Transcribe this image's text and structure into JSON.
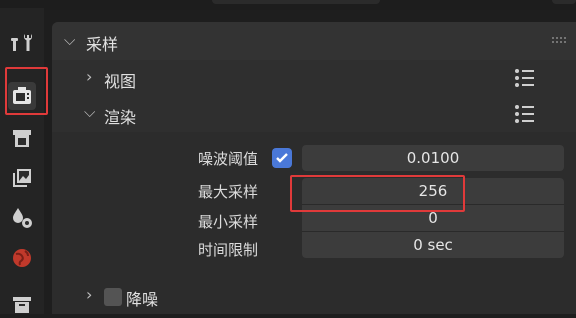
{
  "sidebar": {
    "items": [
      {
        "name": "tool"
      },
      {
        "name": "render",
        "active": true
      },
      {
        "name": "output"
      },
      {
        "name": "view-layer"
      },
      {
        "name": "scene"
      },
      {
        "name": "world"
      },
      {
        "name": "collection"
      }
    ]
  },
  "panel": {
    "title": "采样",
    "subpanels": {
      "viewport_label": "视图",
      "render_label": "渲染",
      "denoise_label": "降噪"
    }
  },
  "properties": {
    "noise_threshold": {
      "label": "噪波阈值",
      "value": "0.0100",
      "enabled": true
    },
    "max_samples": {
      "label": "最大采样",
      "value": "256"
    },
    "min_samples": {
      "label": "最小采样",
      "value": "0"
    },
    "time_limit": {
      "label": "时间限制",
      "value": "0 sec"
    }
  },
  "colors": {
    "accent": "#4a78d8",
    "highlight": "#e03a3a",
    "world_icon": "#c0392b"
  }
}
